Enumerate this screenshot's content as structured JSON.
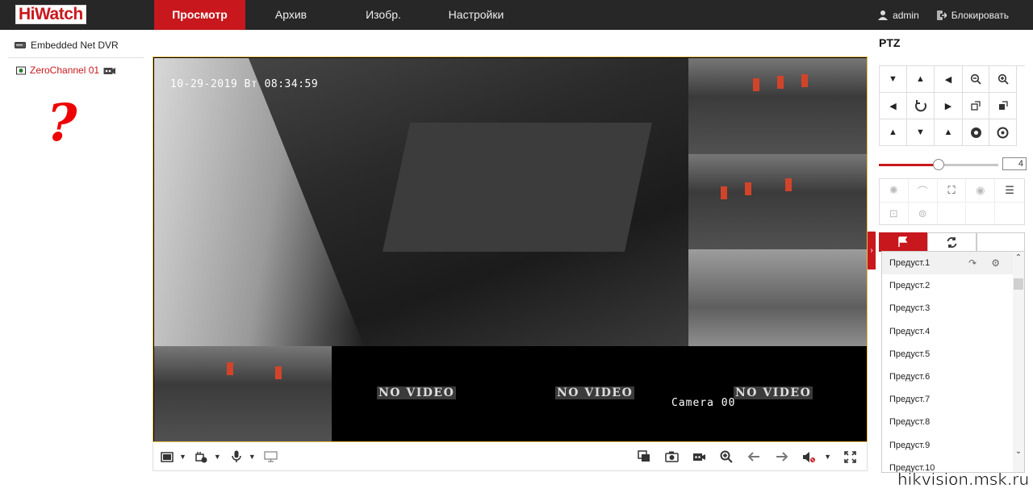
{
  "app": {
    "logo": "HiWatch"
  },
  "nav": {
    "tabs": [
      {
        "label": "Просмотр",
        "active": true
      },
      {
        "label": "Архив"
      },
      {
        "label": "Изобр."
      },
      {
        "label": "Настройки"
      }
    ]
  },
  "user": {
    "name": "admin",
    "lock_label": "Блокировать"
  },
  "tree": {
    "device": "Embedded Net DVR",
    "channel": "ZeroChannel 01",
    "annotation": "?"
  },
  "video": {
    "osd_timestamp": "10-29-2019 Вт 08:34:59",
    "no_video_label": "NO VIDEO",
    "camera_label": "Camera 00"
  },
  "ptz": {
    "title": "PTZ",
    "speed": "4",
    "speed_fraction": 0.5,
    "presets": [
      "Предуст.1",
      "Предуст.2",
      "Предуст.3",
      "Предуст.4",
      "Предуст.5",
      "Предуст.6",
      "Предуст.7",
      "Предуст.8",
      "Предуст.9",
      "Предуст.10"
    ]
  },
  "watermark": "hikvision.msk.ru",
  "colors": {
    "accent": "#c8171d",
    "topbar": "#272727"
  }
}
